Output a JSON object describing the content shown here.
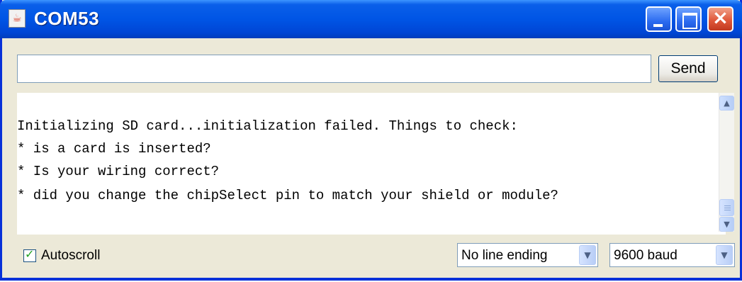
{
  "window": {
    "title": "COM53"
  },
  "send_label": "Send",
  "input_value": "",
  "output_lines": [
    "Initializing SD card...initialization failed. Things to check:",
    "* is a card is inserted?",
    "* Is your wiring correct?",
    "* did you change the chipSelect pin to match your shield or module?"
  ],
  "autoscroll": {
    "label": "Autoscroll",
    "checked": true
  },
  "line_ending": {
    "selected": "No line ending"
  },
  "baud": {
    "selected": "9600 baud"
  },
  "icons": [
    "java-icon",
    "minimize-icon",
    "maximize-icon",
    "close-icon",
    "scroll-up-icon",
    "scroll-down-icon",
    "chevron-down-icon",
    "checkmark-icon"
  ],
  "colors": {
    "titlebar": "#0055e5",
    "frame": "#0831d9",
    "close_button": "#e0583a",
    "face": "#ece9d8"
  }
}
